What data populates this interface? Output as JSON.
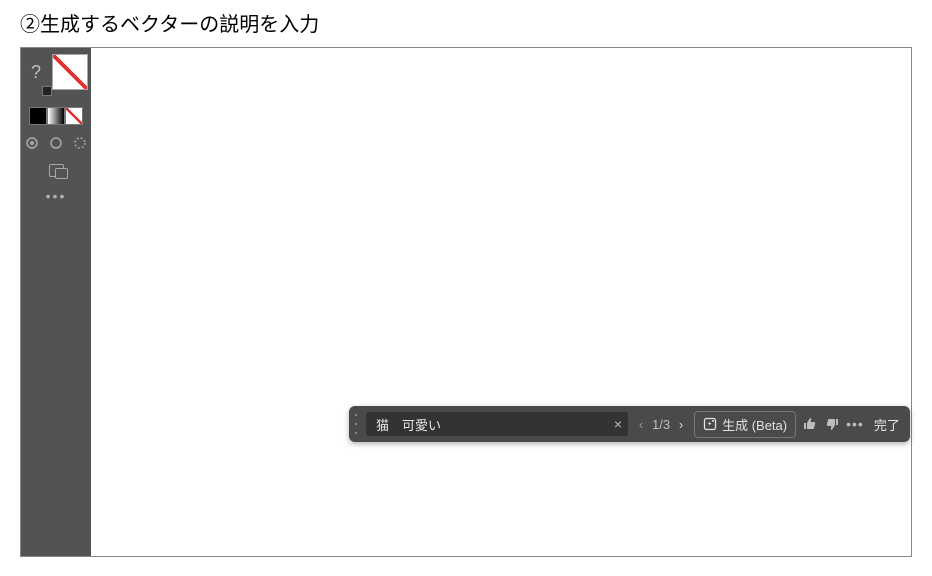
{
  "heading": "②生成するベクターの説明を入力",
  "sidebar": {
    "help": "?",
    "more": "•••"
  },
  "genbar": {
    "prompt": "猫　可愛い",
    "close": "×",
    "prev": "‹",
    "counter": "1/3",
    "next": "›",
    "generate_label": "生成 (Beta)",
    "more": "•••",
    "done": "完了"
  }
}
